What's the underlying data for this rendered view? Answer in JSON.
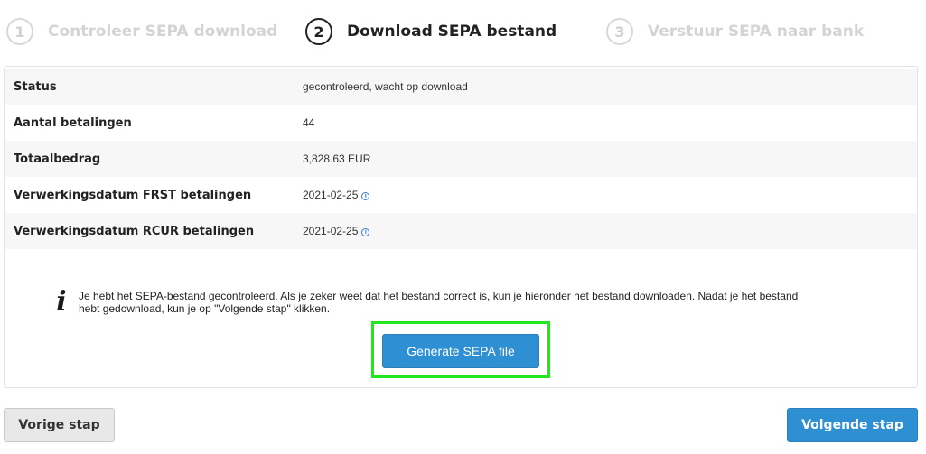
{
  "steps": [
    {
      "number": "1",
      "label": "Controleer SEPA download",
      "state": "done"
    },
    {
      "number": "2",
      "label": "Download SEPA bestand",
      "state": "active"
    },
    {
      "number": "3",
      "label": "Verstuur SEPA naar bank",
      "state": "upcoming"
    }
  ],
  "details": [
    {
      "label": "Status",
      "value": "gecontroleerd, wacht op download"
    },
    {
      "label": "Aantal betalingen",
      "value": "44"
    },
    {
      "label": "Totaalbedrag",
      "value": "3,828.63 EUR"
    },
    {
      "label": "Verwerkingsdatum FRST betalingen",
      "value": "2021-02-25"
    },
    {
      "label": "Verwerkingsdatum RCUR betalingen",
      "value": "2021-02-25"
    }
  ],
  "notice": {
    "icon": "info-icon",
    "line1": "Je hebt het SEPA-bestand gecontroleerd. Als je zeker weet dat het bestand correct is, kun je hieronder het bestand downloaden. Nadat je het bestand",
    "line2": "hebt gedownload, kun je op \"Volgende stap\" klikken."
  },
  "buttons": {
    "generate": "Generate SEPA file",
    "previous": "Vorige stap",
    "next": "Volgende stap"
  },
  "colors": {
    "primary": "#2f8fd3",
    "highlight": "#22e61e",
    "stripe": "#f7f7f7"
  }
}
